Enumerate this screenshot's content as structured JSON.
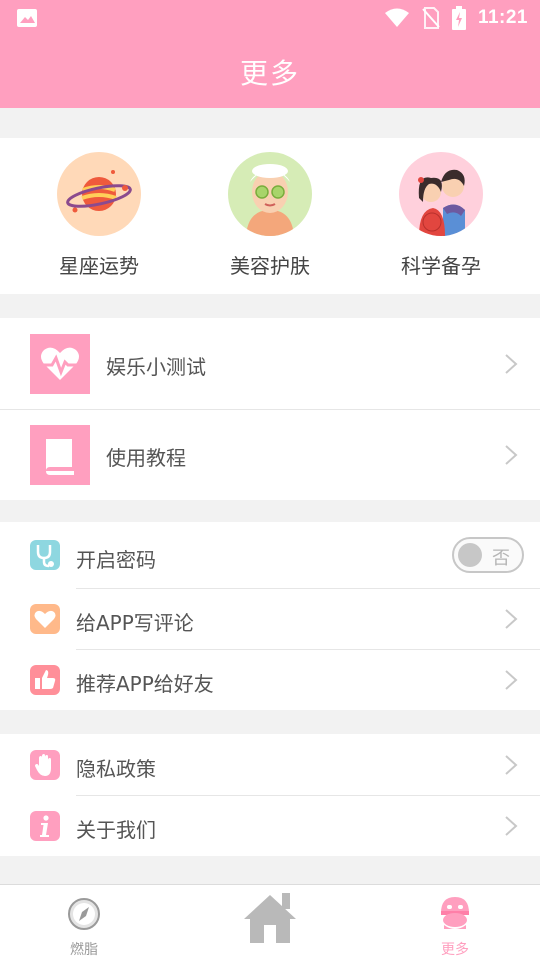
{
  "status_bar": {
    "time": "11:21",
    "icons": [
      "image-icon",
      "wifi-icon",
      "no-sim-icon",
      "battery-charging-icon"
    ]
  },
  "header": {
    "title": "更多"
  },
  "features": [
    {
      "label": "星座运势",
      "icon": "planet-icon"
    },
    {
      "label": "美容护肤",
      "icon": "facial-mask-icon"
    },
    {
      "label": "科学备孕",
      "icon": "couple-icon"
    }
  ],
  "menu_main": [
    {
      "label": "娱乐小测试",
      "icon": "heartbeat-icon"
    },
    {
      "label": "使用教程",
      "icon": "book-icon"
    }
  ],
  "menu_settings": {
    "password": {
      "label": "开启密码",
      "toggle_text": "否",
      "enabled": false,
      "icon_color": "#8ed7e0"
    },
    "review": {
      "label": "给APP写评论",
      "icon_color": "#ffb98a"
    },
    "recommend": {
      "label": "推荐APP给好友",
      "icon_color": "#ff8f99"
    }
  },
  "menu_about": [
    {
      "label": "隐私政策",
      "icon": "hand-icon",
      "icon_color": "#ff9fbf"
    },
    {
      "label": "关于我们",
      "icon": "info-icon",
      "icon_color": "#ff9fbf"
    }
  ],
  "tabs": [
    {
      "label": "燃脂",
      "icon": "compass-icon",
      "active": false
    },
    {
      "label": "",
      "icon": "home-icon",
      "active": false
    },
    {
      "label": "更多",
      "icon": "more-character-icon",
      "active": true
    }
  ],
  "colors": {
    "accent": "#ff9fbf",
    "text": "#555555",
    "tab_inactive": "#9a9a9a"
  }
}
